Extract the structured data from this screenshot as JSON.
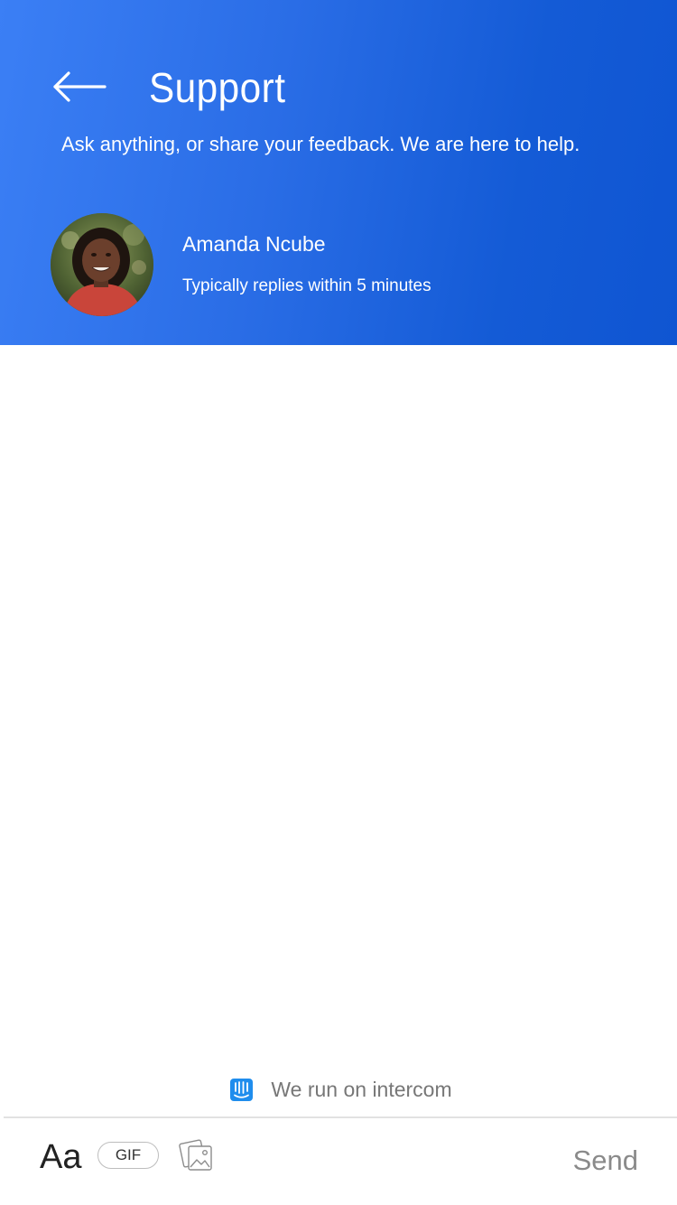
{
  "header": {
    "title": "Support",
    "subtitle": "Ask anything, or share your feedback. We are here to help.",
    "back_icon": "arrow-left-icon",
    "gradient_colors": [
      "#3b7ff5",
      "#0f55d2"
    ]
  },
  "agent": {
    "name": "Amanda Ncube",
    "status": "Typically replies within 5 minutes",
    "avatar_icon": "agent-avatar"
  },
  "branding": {
    "icon": "intercom-logo-icon",
    "text": "We run on intercom",
    "icon_color": "#1f8ded"
  },
  "composer": {
    "format_label": "Aa",
    "gif_label": "GIF",
    "image_icon": "image-attach-icon",
    "send_label": "Send"
  }
}
